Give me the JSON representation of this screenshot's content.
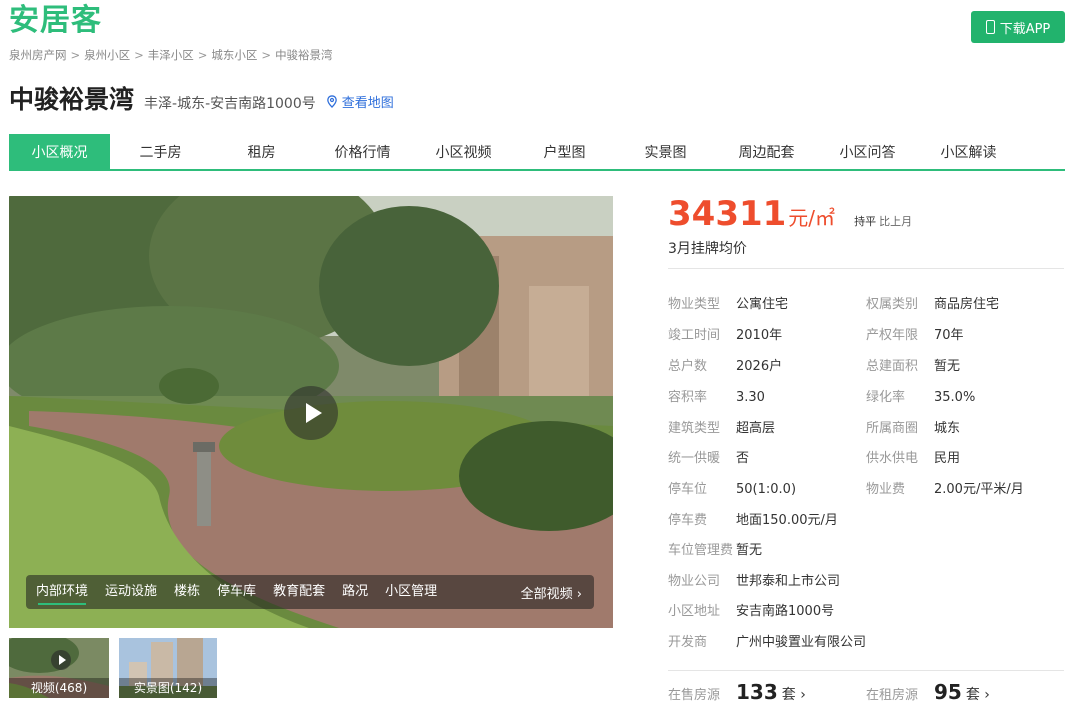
{
  "header": {
    "logo": "安居客",
    "app_button": "下载APP"
  },
  "breadcrumb": [
    "泉州房产网",
    "泉州小区",
    "丰泽小区",
    "城东小区",
    "中骏裕景湾"
  ],
  "community": {
    "name": "中骏裕景湾",
    "address": "丰泽-城东-安吉南路1000号",
    "map_link": "查看地图"
  },
  "tabs": [
    "小区概况",
    "二手房",
    "租房",
    "价格行情",
    "小区视频",
    "户型图",
    "实景图",
    "周边配套",
    "小区问答",
    "小区解读"
  ],
  "active_tab": "小区概况",
  "media": {
    "categories": [
      "内部环境",
      "运动设施",
      "楼栋",
      "停车库",
      "教育配套",
      "路况",
      "小区管理"
    ],
    "active_category": "内部环境",
    "all_videos": "全部视频 ›",
    "thumbs": [
      {
        "label": "视频(468)",
        "kind": "video"
      },
      {
        "label": "实景图(142)",
        "kind": "photo"
      }
    ]
  },
  "price": {
    "value": "34311",
    "unit": "元/㎡",
    "trend": "持平",
    "compare": "比上月",
    "label": "3月挂牌均价"
  },
  "details": [
    {
      "key": "物业类型",
      "value": "公寓住宅"
    },
    {
      "key": "权属类别",
      "value": "商品房住宅"
    },
    {
      "key": "竣工时间",
      "value": "2010年"
    },
    {
      "key": "产权年限",
      "value": "70年"
    },
    {
      "key": "总户数",
      "value": "2026户"
    },
    {
      "key": "总建面积",
      "value": "暂无"
    },
    {
      "key": "容积率",
      "value": "3.30"
    },
    {
      "key": "绿化率",
      "value": "35.0%"
    },
    {
      "key": "建筑类型",
      "value": "超高层"
    },
    {
      "key": "所属商圈",
      "value": "城东"
    },
    {
      "key": "统一供暖",
      "value": "否"
    },
    {
      "key": "供水供电",
      "value": "民用"
    },
    {
      "key": "停车位",
      "value": "50(1:0.0)"
    },
    {
      "key": "物业费",
      "value": "2.00元/平米/月"
    },
    {
      "key": "停车费",
      "value": "地面150.00元/月"
    },
    {
      "key": "车位管理费",
      "value": "暂无"
    },
    {
      "key": "物业公司",
      "value": "世邦泰和上市公司"
    },
    {
      "key": "小区地址",
      "value": "安吉南路1000号"
    },
    {
      "key": "开发商",
      "value": "广州中骏置业有限公司"
    }
  ],
  "listings": {
    "sale": {
      "label": "在售房源",
      "count": "133",
      "unit": "套 ›"
    },
    "rent": {
      "label": "在租房源",
      "count": "95",
      "unit": "套 ›"
    }
  },
  "colors": {
    "brand": "#2ebd7b",
    "price": "#ee4d2d",
    "link": "#2f6fdb"
  }
}
